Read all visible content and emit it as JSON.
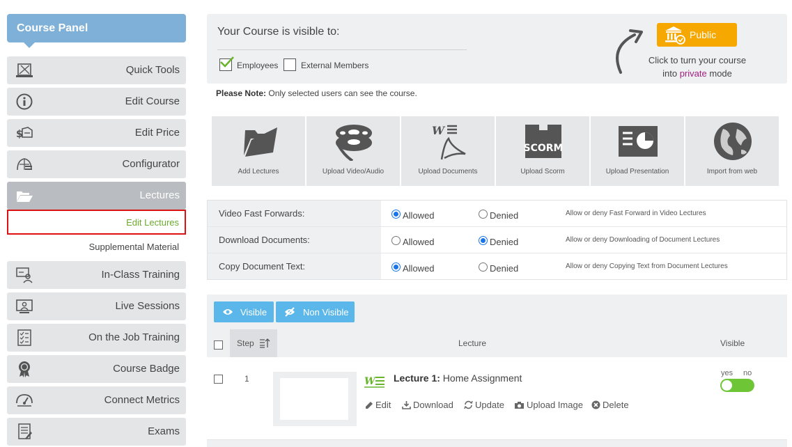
{
  "sidebar": {
    "title": "Course Panel",
    "items": [
      {
        "label": "Quick Tools"
      },
      {
        "label": "Edit Course"
      },
      {
        "label": "Edit Price"
      },
      {
        "label": "Configurator"
      },
      {
        "label": "Lectures"
      },
      {
        "label": "In-Class Training"
      },
      {
        "label": "Live Sessions"
      },
      {
        "label": "On the Job Training"
      },
      {
        "label": "Course Badge"
      },
      {
        "label": "Connect Metrics"
      },
      {
        "label": "Exams"
      }
    ],
    "sub_items": [
      {
        "label": "Edit Lectures"
      },
      {
        "label": "Supplemental Material"
      }
    ]
  },
  "visibility": {
    "title": "Your Course is visible to:",
    "employees_label": "Employees",
    "employees_checked": true,
    "external_label": "External Members",
    "external_checked": false,
    "public_label": "Public",
    "note_line1": "Click to turn your course",
    "note_into": "into",
    "note_private": "private",
    "note_mode": "mode"
  },
  "please_note": {
    "label": "Please Note:",
    "text": " Only selected users can see the course."
  },
  "tools": [
    {
      "label": "Add Lectures",
      "icon": "folder-icon"
    },
    {
      "label": "Upload Video/Audio",
      "icon": "film-reel-icon"
    },
    {
      "label": "Upload Documents",
      "icon": "documents-icon"
    },
    {
      "label": "Upload Scorm",
      "icon": "scorm-box-icon"
    },
    {
      "label": "Upload Presentation",
      "icon": "presentation-icon"
    },
    {
      "label": "Import from web",
      "icon": "globe-icon"
    }
  ],
  "settings": [
    {
      "name": "Video Fast Forwards:",
      "allowed": "Allowed",
      "denied": "Denied",
      "value": "allowed",
      "description": "Allow or deny Fast Forward in Video Lectures"
    },
    {
      "name": "Download Documents:",
      "allowed": "Allowed",
      "denied": "Denied",
      "value": "denied",
      "description": "Allow or deny Downloading of Document Lectures"
    },
    {
      "name": "Copy Document Text:",
      "allowed": "Allowed",
      "denied": "Denied",
      "value": "allowed",
      "description": "Allow or deny Copying Text from Document Lectures"
    }
  ],
  "lectures": {
    "visible_btn": "Visible",
    "non_visible_btn": "Non Visible",
    "headers": {
      "step": "Step",
      "lecture": "Lecture",
      "visible": "Visible"
    },
    "rows": [
      {
        "step": "1",
        "title_prefix": "Lecture 1:",
        "title": " Home Assignment",
        "actions": {
          "edit": "Edit",
          "download": "Download",
          "update": "Update",
          "upload_image": "Upload Image",
          "delete": "Delete"
        },
        "toggle_yes": "yes",
        "toggle_no": "no",
        "visible": true
      }
    ]
  },
  "colors": {
    "accent": "#7fb1d8",
    "public": "#f7a800",
    "button": "#5bb6ea",
    "toggle": "#6ec636",
    "selected_sub": "#6aab2e"
  }
}
